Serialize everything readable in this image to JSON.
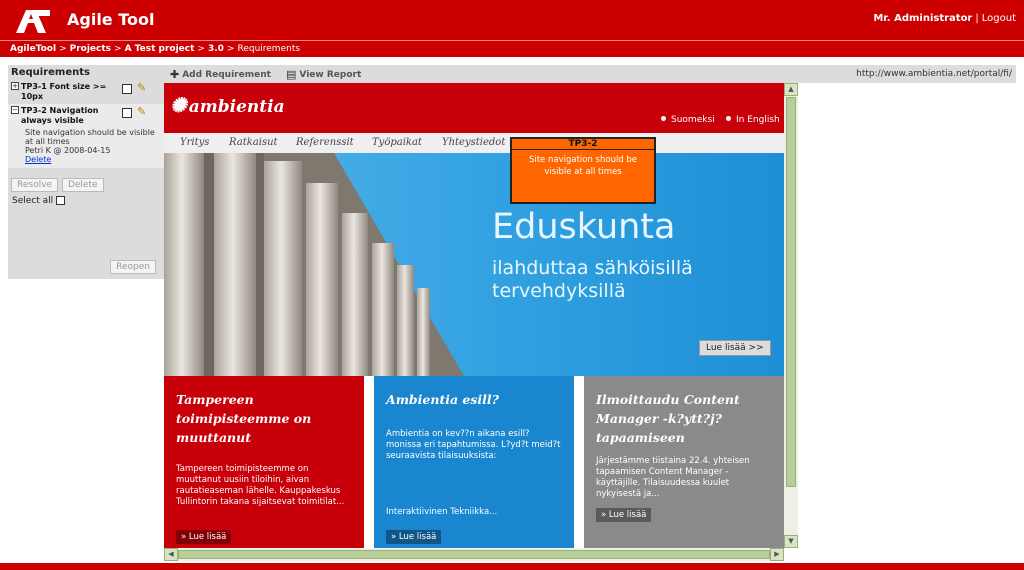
{
  "app": {
    "title": "Agile Tool",
    "user": "Mr. Administrator",
    "user_sep": "|",
    "logout": "Logout"
  },
  "breadcrumb": {
    "items": [
      "AgileTool",
      "Projects",
      "A Test project",
      "3.0",
      "Requirements"
    ],
    "sep": ">"
  },
  "requirements": {
    "title": "Requirements",
    "items": [
      {
        "toggle": "+",
        "label": "TP3-1 Font size >= 10px"
      },
      {
        "toggle": "−",
        "label": "TP3-2 Navigation always visible",
        "detail": "Site navigation should be visible at all times",
        "meta": "Petri K @ 2008-04-15",
        "delete_link": "Delete"
      }
    ],
    "resolve": "Resolve",
    "delete": "Delete",
    "select_all": "Select all",
    "reopen": "Reopen"
  },
  "toolbar": {
    "add": "Add Requirement",
    "report": "View Report",
    "url": "http://www.ambientia.net/portal/fi/"
  },
  "site": {
    "logo": "ambientia",
    "lang": [
      "Suomeksi",
      "In English"
    ],
    "nav": [
      "Yritys",
      "Ratkaisut",
      "Referenssit",
      "Työpaikat",
      "Yhteystiedot"
    ],
    "hero": {
      "title": "Eduskunta",
      "sub1": "ilahduttaa sähköisillä",
      "sub2": "tervehdyksillä",
      "button": "Lue lisää >>"
    },
    "columns": [
      {
        "heading": "Tampereen toimipisteemme on muuttanut",
        "text": "Tampereen toimipisteemme on muuttanut uusiin tiloihin, aivan rautatieaseman lähelle. Kauppakeskus Tullintorin takana sijaitsevat toimitilat...",
        "more": "» Lue lisää"
      },
      {
        "heading": "Ambientia esill?",
        "text": "Ambientia on kev??n aikana esill? monissa eri tapahtumissa. L?yd?t meid?t seuraavista tilaisuuksista:",
        "link": "Interaktiivinen Tekniikka...",
        "more": "» Lue lisää"
      },
      {
        "heading": "Ilmoittaudu Content Manager -k?ytt?j?tapaamiseen",
        "text": "Järjestämme tiistaina 22.4. yhteisen tapaamisen Content Manager -käyttäjille. Tilaisuudessa kuulet nykyisestä ja...",
        "more": "» Lue lisää"
      }
    ]
  },
  "annotation": {
    "title": "TP3-2",
    "text": "Site navigation should be visible at all times",
    "color": "#ff6600"
  },
  "colors": {
    "brand": "#cc0000",
    "panel": "#dcdcdc",
    "site_red": "#c8000a",
    "site_blue": "#1a86cf",
    "site_gray": "#8a8a8a"
  }
}
